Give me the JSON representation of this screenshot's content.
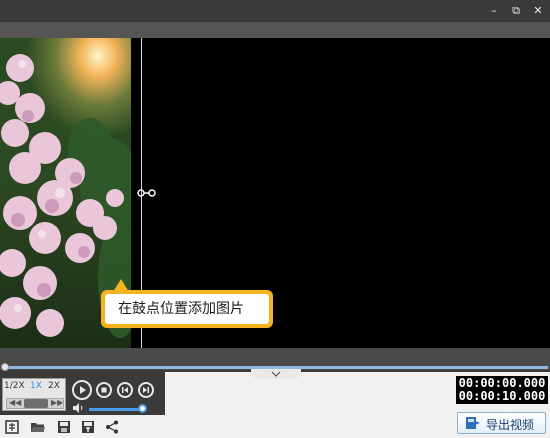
{
  "window": {
    "controls": {
      "minimize_icon": "minimize-icon",
      "restore_icon": "restore-icon",
      "close_icon": "close-icon"
    },
    "minimize_glyph": "–",
    "restore_glyph": "⧉",
    "close_glyph": "✕"
  },
  "preview": {
    "tooltip": "在鼓点位置添加图片",
    "tooltip_color": "#f5b41f"
  },
  "playback": {
    "speeds": [
      "1/2X",
      "1X",
      "2X"
    ],
    "active_speed": "1X",
    "rewind_glyph": "◀◀",
    "forward_glyph": "▶▶",
    "volume_level": 1.0,
    "timeline_position": 0.0,
    "current_time": "00:00:00.000",
    "total_time": "00:00:10.000"
  },
  "toolbar": {
    "icons": [
      "new-project-icon",
      "open-folder-icon",
      "save-icon",
      "save-as-icon",
      "share-icon"
    ],
    "export_label": "导出视频",
    "export_icon": "export-video-icon"
  },
  "colors": {
    "accent": "#4a9be8",
    "timeline": "#8fb6e0",
    "background": "#3a3a3a"
  }
}
